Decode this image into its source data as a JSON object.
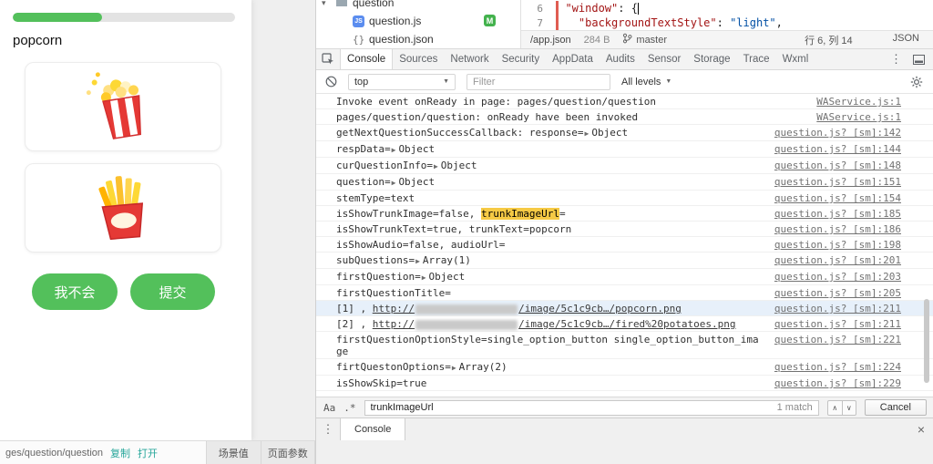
{
  "simulator": {
    "progress_percent": 40,
    "question_text": "popcorn",
    "answer_buttons": {
      "skip_label": "我不会",
      "submit_label": "提交"
    },
    "footer": {
      "path": "ges/question/question",
      "copy_link": "复制",
      "open_link": "打开",
      "tabs": [
        "场景值",
        "页面参数"
      ]
    }
  },
  "filetree": {
    "folder_label": "question",
    "files": [
      {
        "label": "question.js",
        "badge": "M"
      },
      {
        "label": "question.json"
      }
    ]
  },
  "editor": {
    "lines": [
      {
        "number": "6",
        "cursor": true,
        "tokens": [
          {
            "text": "  ",
            "type": "plain"
          },
          {
            "text": "\"window\"",
            "type": "key"
          },
          {
            "text": ": ",
            "type": "plain"
          },
          {
            "text": "{",
            "type": "plain"
          }
        ]
      },
      {
        "number": "7",
        "tokens": [
          {
            "text": "    ",
            "type": "plain"
          },
          {
            "text": "\"backgroundTextStyle\"",
            "type": "key"
          },
          {
            "text": ": ",
            "type": "plain"
          },
          {
            "text": "\"light\"",
            "type": "string"
          },
          {
            "text": ",",
            "type": "plain"
          }
        ]
      }
    ],
    "status_bar": {
      "file": "/app.json",
      "size": "284 B",
      "branch": "master",
      "cursor_position": "行 6, 列 14",
      "language": "JSON"
    }
  },
  "devtools": {
    "tabs": [
      "Console",
      "Sources",
      "Network",
      "Security",
      "AppData",
      "Audits",
      "Sensor",
      "Storage",
      "Trace",
      "Wxml"
    ],
    "active_tab": "Console",
    "toolbar": {
      "context": "top",
      "filter_placeholder": "Filter",
      "levels": "All levels"
    },
    "logs": [
      {
        "segments": [
          {
            "type": "text",
            "text": "Invoke event onReady in page: pages/question/question"
          }
        ],
        "source": "WAService.js:1"
      },
      {
        "segments": [
          {
            "type": "text",
            "text": "pages/question/question: onReady have been invoked"
          }
        ],
        "source": "WAService.js:1"
      },
      {
        "segments": [
          {
            "type": "text",
            "text": "getNextQuestionSuccessCallback: response="
          },
          {
            "type": "expander"
          },
          {
            "type": "text",
            "text": "Object"
          }
        ],
        "source": "question.js? [sm]:142"
      },
      {
        "segments": [
          {
            "type": "text",
            "text": "respData="
          },
          {
            "type": "expander"
          },
          {
            "type": "text",
            "text": "Object"
          }
        ],
        "source": "question.js? [sm]:144"
      },
      {
        "segments": [
          {
            "type": "text",
            "text": "curQuestionInfo="
          },
          {
            "type": "expander"
          },
          {
            "type": "text",
            "text": "Object"
          }
        ],
        "source": "question.js? [sm]:148"
      },
      {
        "segments": [
          {
            "type": "text",
            "text": "question="
          },
          {
            "type": "expander"
          },
          {
            "type": "text",
            "text": "Object"
          }
        ],
        "source": "question.js? [sm]:151"
      },
      {
        "segments": [
          {
            "type": "text",
            "text": "stemType=text"
          }
        ],
        "source": "question.js? [sm]:154"
      },
      {
        "segments": [
          {
            "type": "text",
            "text": "isShowTrunkImage=false, "
          },
          {
            "type": "match",
            "text": "trunkImageUrl"
          },
          {
            "type": "text",
            "text": "="
          }
        ],
        "source": "question.js? [sm]:185"
      },
      {
        "segments": [
          {
            "type": "text",
            "text": "isShowTrunkText=true, trunkText=popcorn"
          }
        ],
        "source": "question.js? [sm]:186"
      },
      {
        "segments": [
          {
            "type": "text",
            "text": "isShowAudio=false, audioUrl="
          }
        ],
        "source": "question.js? [sm]:198"
      },
      {
        "segments": [
          {
            "type": "text",
            "text": "subQuestions="
          },
          {
            "type": "expander"
          },
          {
            "type": "text",
            "text": "Array(1)"
          }
        ],
        "source": "question.js? [sm]:201"
      },
      {
        "segments": [
          {
            "type": "text",
            "text": "firstQuestion="
          },
          {
            "type": "expander"
          },
          {
            "type": "text",
            "text": "Object"
          }
        ],
        "source": "question.js? [sm]:203"
      },
      {
        "segments": [
          {
            "type": "text",
            "text": "firstQuestionTitle="
          }
        ],
        "source": "question.js? [sm]:205"
      },
      {
        "selected": true,
        "segments": [
          {
            "type": "text",
            "text": "[1] , "
          },
          {
            "type": "link",
            "text": "http://"
          },
          {
            "type": "redacted"
          },
          {
            "type": "link",
            "text": "/image/5c1c9cb…/popcorn.png"
          }
        ],
        "source": "question.js? [sm]:211"
      },
      {
        "segments": [
          {
            "type": "text",
            "text": "[2] , "
          },
          {
            "type": "link",
            "text": "http://"
          },
          {
            "type": "redacted"
          },
          {
            "type": "link",
            "text": "/image/5c1c9cb…/fired%20potatoes.png"
          }
        ],
        "source": "question.js? [sm]:211"
      },
      {
        "segments": [
          {
            "type": "text",
            "text": "firstQuestionOptionStyle=single_option_button single_option_button_image"
          }
        ],
        "source": "question.js? [sm]:221"
      },
      {
        "segments": [
          {
            "type": "text",
            "text": "firtQuestonOptions="
          },
          {
            "type": "expander"
          },
          {
            "type": "text",
            "text": "Array(2)"
          }
        ],
        "source": "question.js? [sm]:224"
      },
      {
        "segments": [
          {
            "type": "text",
            "text": "isShowSkip=true"
          }
        ],
        "source": "question.js? [sm]:229"
      }
    ],
    "prompt": ">",
    "search": {
      "match_case": "Aa",
      "regex": ".*",
      "query": "trunkImageUrl",
      "match_count": "1 match",
      "cancel_label": "Cancel"
    },
    "drawer_tab": "Console"
  },
  "icons": {
    "kebab": "⋮",
    "close": "×",
    "dropdown_arrow": "▼",
    "tree_arrow": "▾",
    "expander": "▶",
    "nav_up": "∧",
    "nav_down": "∨",
    "braces": "{}",
    "js_badge": "JS"
  }
}
